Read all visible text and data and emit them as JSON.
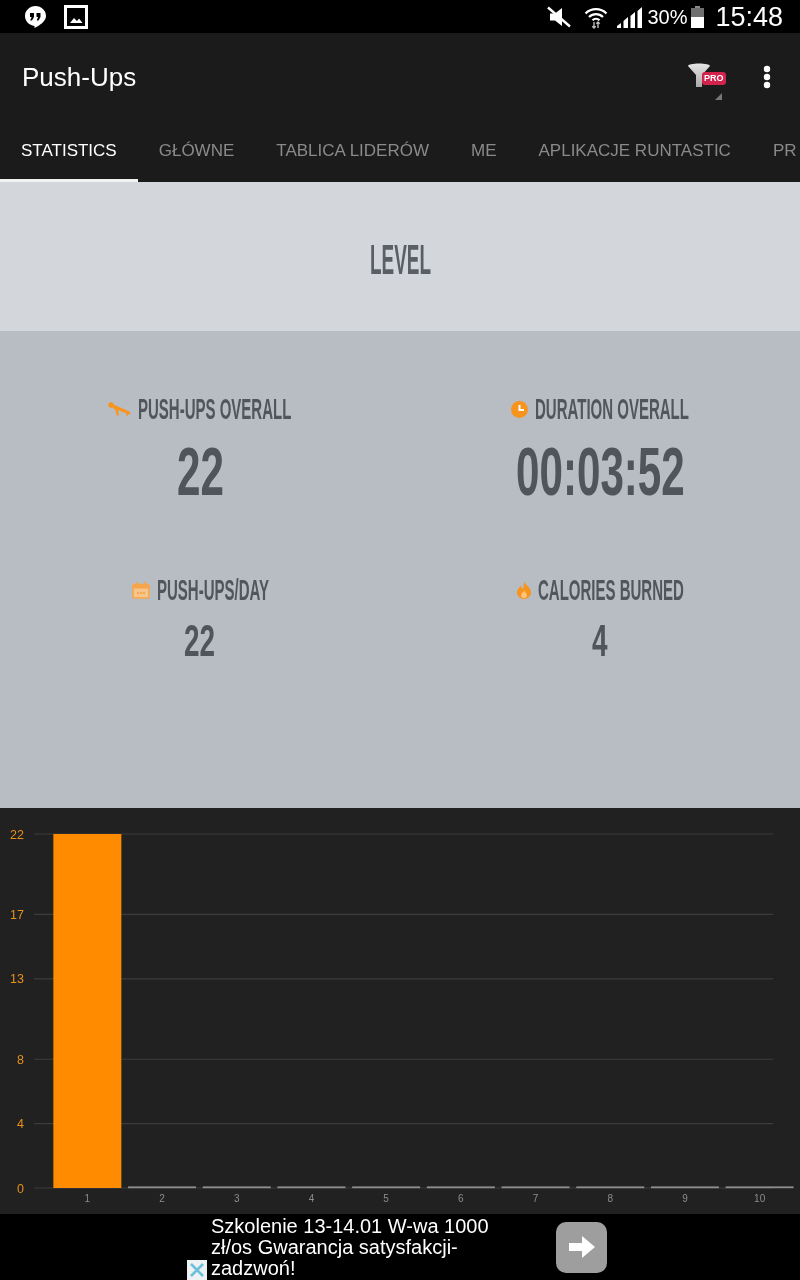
{
  "status_bar": {
    "battery": "30%",
    "time": "15:48"
  },
  "toolbar": {
    "title": "Push-Ups",
    "filter_badge": "PRO"
  },
  "tabs": [
    {
      "label": "STATISTICS",
      "selected": true
    },
    {
      "label": "GŁÓWNE",
      "selected": false
    },
    {
      "label": "TABLICA LIDERÓW",
      "selected": false
    },
    {
      "label": "ME",
      "selected": false
    },
    {
      "label": "APLIKACJE RUNTASTIC",
      "selected": false
    },
    {
      "label": "PR",
      "selected": false
    }
  ],
  "level": {
    "title": "LEVEL"
  },
  "stats": [
    {
      "label": "PUSH-UPS OVERALL",
      "value": "22"
    },
    {
      "label": "DURATION OVERALL",
      "value": "00:03:52"
    },
    {
      "label": "PUSH-UPS/DAY",
      "value": "22"
    },
    {
      "label": "CALORIES BURNED",
      "value": "4"
    }
  ],
  "chart": {
    "chart_data": {
      "type": "bar",
      "categories": [
        "1",
        "2",
        "3",
        "4",
        "5",
        "6",
        "7",
        "8",
        "9",
        "10"
      ],
      "series": [
        {
          "color": "#ff8c00",
          "values": [
            22,
            0,
            0,
            0,
            0,
            0,
            0,
            0,
            0,
            0
          ]
        }
      ],
      "ylim": [
        0,
        22
      ],
      "yticks": [
        0,
        4,
        8,
        13,
        17,
        22
      ],
      "grid": true
    }
  },
  "ad": {
    "text": "Szkolenie 13-14.01 W-wa 1000 zł/os Gwarancja satysfakcji-zadzwoń!"
  }
}
